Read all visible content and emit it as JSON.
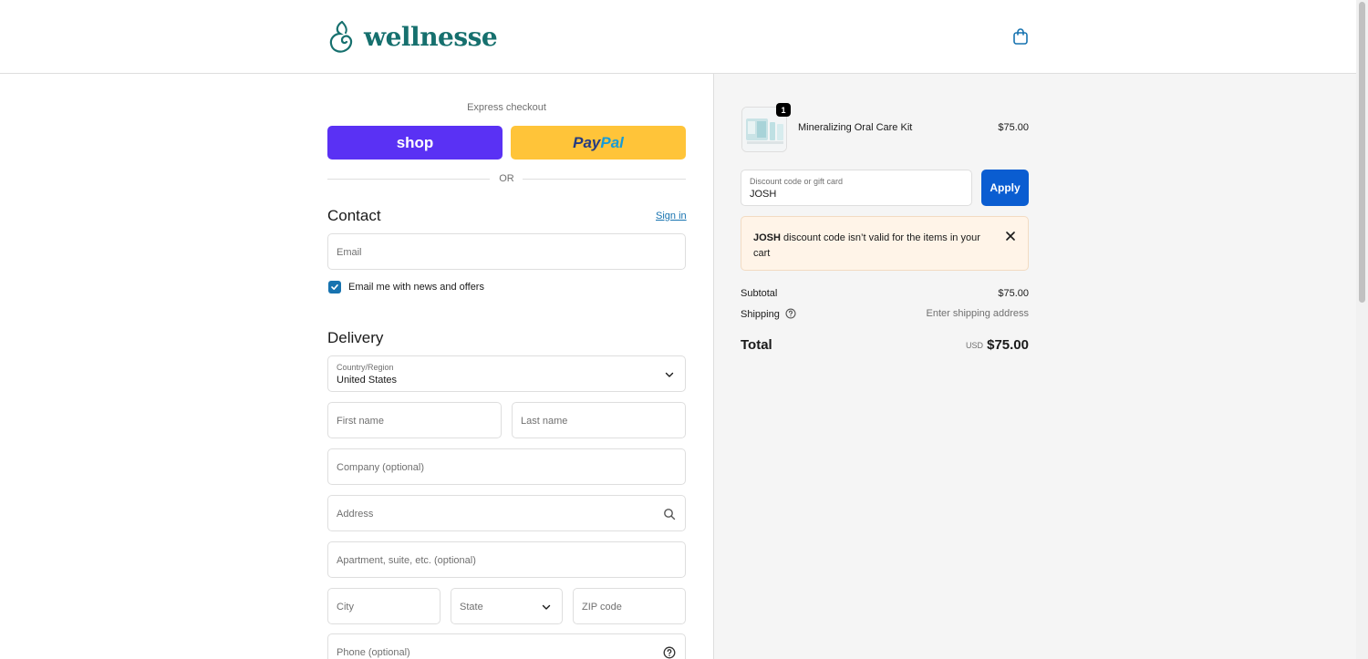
{
  "brand": {
    "name": "wellnesse",
    "color": "#16706e"
  },
  "header": {
    "cart_icon": "shopping-bag-icon"
  },
  "express": {
    "label": "Express checkout",
    "shop_label": "shop",
    "paypal_pay": "Pay",
    "paypal_pal": "Pal",
    "or_label": "OR"
  },
  "contact": {
    "title": "Contact",
    "signin_label": "Sign in",
    "email_placeholder": "Email",
    "newsletter_label": "Email me with news and offers",
    "newsletter_checked": true
  },
  "delivery": {
    "title": "Delivery",
    "country_label": "Country/Region",
    "country_value": "United States",
    "first_name_placeholder": "First name",
    "last_name_placeholder": "Last name",
    "company_placeholder": "Company (optional)",
    "address_placeholder": "Address",
    "apartment_placeholder": "Apartment, suite, etc. (optional)",
    "city_placeholder": "City",
    "state_placeholder": "State",
    "zip_placeholder": "ZIP code",
    "phone_placeholder": "Phone (optional)"
  },
  "order": {
    "item": {
      "name": "Mineralizing Oral Care Kit",
      "price": "$75.00",
      "quantity": "1"
    },
    "discount": {
      "label": "Discount code or gift card",
      "value": "JOSH",
      "apply_label": "Apply"
    },
    "alert": {
      "code": "JOSH",
      "message": " discount code isn’t valid for the items in your cart"
    },
    "subtotal_label": "Subtotal",
    "subtotal_value": "$75.00",
    "shipping_label": "Shipping",
    "shipping_value": "Enter shipping address",
    "total_label": "Total",
    "total_currency": "USD",
    "total_value": "$75.00"
  },
  "colors": {
    "shop_button": "#5a31f4",
    "paypal_button": "#ffc439",
    "link": "#1773b0",
    "apply_button": "#0a5dd1",
    "alert_bg": "#fff4e8"
  }
}
